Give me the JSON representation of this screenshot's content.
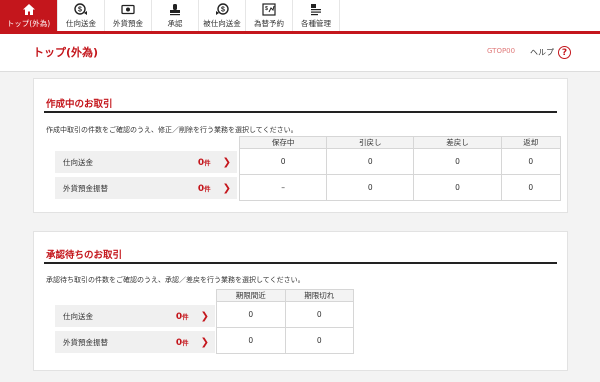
{
  "nav": {
    "items": [
      {
        "label": "トップ(外為)",
        "icon": "home-icon"
      },
      {
        "label": "仕向送金",
        "icon": "outgoing-remittance-icon"
      },
      {
        "label": "外貨預金",
        "icon": "foreign-deposit-icon"
      },
      {
        "label": "承認",
        "icon": "approval-icon"
      },
      {
        "label": "被仕向送金",
        "icon": "incoming-remittance-icon"
      },
      {
        "label": "為替予約",
        "icon": "exchange-contract-icon"
      },
      {
        "label": "各種管理",
        "icon": "management-icon"
      }
    ],
    "active_color": "#c4161c"
  },
  "header": {
    "title": "トップ(外為)",
    "screen_id": "GTOP00",
    "help_label": "ヘルプ",
    "help_icon_text": "?"
  },
  "in_progress": {
    "title": "作成中のお取引",
    "description": "作成中取引の件数をご確認のうえ、修正／削除を行う業務を選択してください。",
    "columns": [
      "保存中",
      "引戻し",
      "差戻し",
      "返却"
    ],
    "rows": [
      {
        "label": "仕向送金",
        "count": "0",
        "unit": "件",
        "cells": [
          "0",
          "0",
          "0",
          "0"
        ]
      },
      {
        "label": "外貨預金振替",
        "count": "0",
        "unit": "件",
        "cells": [
          "–",
          "0",
          "0",
          "0"
        ]
      }
    ]
  },
  "awaiting": {
    "title": "承認待ちのお取引",
    "description": "承認待ち取引の件数をご確認のうえ、承認／差戻を行う業務を選択してください。",
    "columns": [
      "期限間近",
      "期限切れ"
    ],
    "rows": [
      {
        "label": "仕向送金",
        "count": "0",
        "unit": "件",
        "cells": [
          "0",
          "0"
        ]
      },
      {
        "label": "外貨預金振替",
        "count": "0",
        "unit": "件",
        "cells": [
          "0",
          "0"
        ]
      }
    ]
  }
}
